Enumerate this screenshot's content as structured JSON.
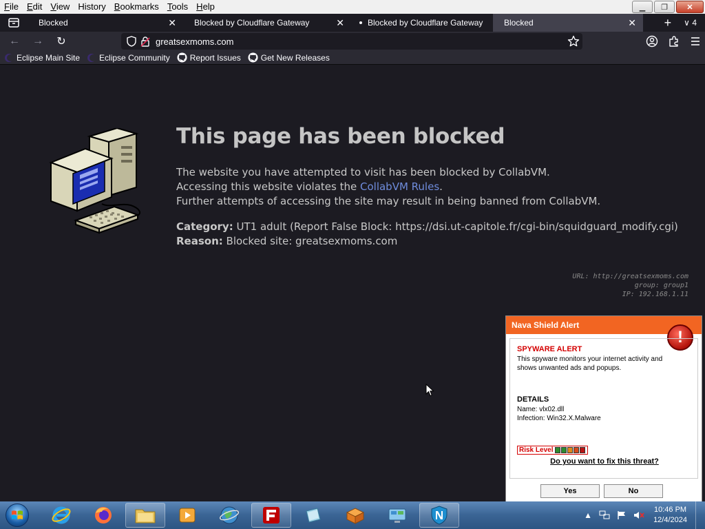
{
  "menubar": {
    "items": [
      {
        "label": "File",
        "key": "F",
        "rest": "ile"
      },
      {
        "label": "Edit",
        "key": "E",
        "rest": "dit"
      },
      {
        "label": "View",
        "key": "V",
        "rest": "iew"
      },
      {
        "label": "History",
        "key": "H",
        "rest": "istory"
      },
      {
        "label": "Bookmarks",
        "key": "B",
        "rest": "ookmarks"
      },
      {
        "label": "Tools",
        "key": "T",
        "rest": "ools"
      },
      {
        "label": "Help",
        "key": "H",
        "rest": "elp"
      }
    ]
  },
  "tabs": [
    {
      "title": "Blocked",
      "active": false
    },
    {
      "title": "Blocked by Cloudflare Gateway",
      "active": false
    },
    {
      "title": "Blocked by Cloudflare Gateway",
      "active": false,
      "attention": true
    },
    {
      "title": "Blocked",
      "active": true
    }
  ],
  "tab_count": "4",
  "urlbar": {
    "url": "greatsexmoms.com"
  },
  "bookmarks": [
    {
      "label": "Eclipse Main Site",
      "icon": "eclipse-icon"
    },
    {
      "label": "Eclipse Community",
      "icon": "eclipse-icon"
    },
    {
      "label": "Report Issues",
      "icon": "github-icon"
    },
    {
      "label": "Get New Releases",
      "icon": "github-icon"
    }
  ],
  "block_page": {
    "title": "This page has been blocked",
    "line1": "The website you have attempted to visit has been blocked by CollabVM.",
    "line2_pre": "Accessing this website violates the ",
    "line2_link": "CollabVM Rules",
    "line2_post": ".",
    "line3": "Further attempts of accessing the site may result in being banned from CollabVM.",
    "category_label": "Category:",
    "category_value": "UT1 adult (Report False Block: https://dsi.ut-capitole.fr/cgi-bin/squidguard_modify.cgi)",
    "reason_label": "Reason:",
    "reason_value": "Blocked site: greatsexmoms.com",
    "debug_url": "URL: http://greatsexmoms.com",
    "debug_group": "group: group1",
    "debug_ip": "IP: 192.168.1.11"
  },
  "popup": {
    "header": "Nava Shield Alert",
    "spyware_title": "SPYWARE ALERT",
    "spyware_desc": "This spyware monitors your internet activity and shows unwanted ads and popups.",
    "details_title": "DETAILS",
    "details_name": "Name: vlx02.dll",
    "details_infection": "Infection: Win32.X.Malware",
    "risk_label": "Risk Level",
    "risk_colors": [
      "#2e8b2e",
      "#2e8b2e",
      "#e08a1a",
      "#d44a1a",
      "#b81414"
    ],
    "question": "Do you want to fix this threat?",
    "yes_label": "Yes",
    "no_label": "No"
  },
  "taskbar": {
    "apps": [
      "internet-explorer",
      "firefox",
      "file-explorer",
      "media-player",
      "network-globe",
      "filezilla",
      "notepad",
      "package-box",
      "control-panel",
      "nava-shield"
    ],
    "clock_time": "10:46 PM",
    "clock_date": "12/4/2024"
  },
  "colors": {
    "accent_orange": "#f26522",
    "link": "#6f8cdc",
    "alert_red": "#d40000"
  }
}
